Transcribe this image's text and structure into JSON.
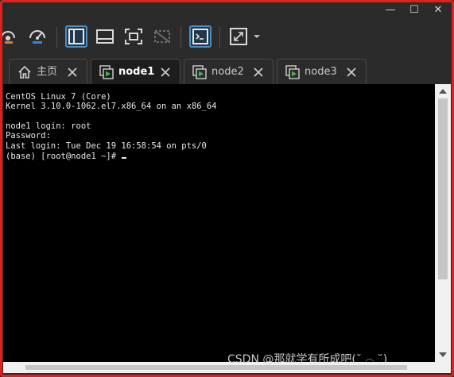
{
  "window": {
    "controls": {
      "minimize": "—",
      "maximize": "☐",
      "close": "✕"
    }
  },
  "toolbar": {
    "buttons": [
      {
        "name": "snapshot-revert-icon",
        "active": false
      },
      {
        "name": "snapshot-manager-icon",
        "active": false
      },
      {
        "name": "library-panel-icon",
        "active": true
      },
      {
        "name": "thumbnail-bar-icon",
        "active": false
      },
      {
        "name": "fullscreen-icon",
        "active": false
      },
      {
        "name": "unity-disabled-icon",
        "active": false
      },
      {
        "name": "console-view-icon",
        "active": true
      },
      {
        "name": "stretch-guest-icon",
        "active": false
      }
    ]
  },
  "tabs": [
    {
      "label": "主页",
      "icon": "home-icon",
      "active": false
    },
    {
      "label": "node1",
      "icon": "vm-running-icon",
      "active": true
    },
    {
      "label": "node2",
      "icon": "vm-running-icon",
      "active": false
    },
    {
      "label": "node3",
      "icon": "vm-running-icon",
      "active": false
    }
  ],
  "terminal": {
    "lines": [
      "CentOS Linux 7 (Core)",
      "Kernel 3.10.0-1062.el7.x86_64 on an x86_64",
      "",
      "node1 login: root",
      "Password:",
      "Last login: Tue Dec 19 16:58:54 on pts/0",
      "(base) [root@node1 ~]# "
    ]
  },
  "watermark": "CSDN @那就学有所成吧(˘̩̩̩̩̩̩ ⌓ ˘̩̩̩̩̩̩)",
  "colors": {
    "frame": "#e0211b",
    "accent": "#4a90c2",
    "vm_icon": "#3cb84a"
  }
}
